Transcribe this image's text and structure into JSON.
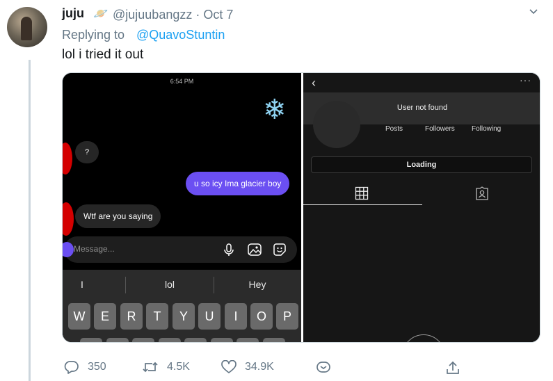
{
  "tweet": {
    "author_name": "juju",
    "author_emoji": "🪐",
    "handle": "@jujuubangzz",
    "separator": "·",
    "date": "Oct 7",
    "replying_prefix": "Replying to",
    "replying_to": "@QuavoStuntin",
    "text": "lol i tried it out"
  },
  "left_screenshot": {
    "status_time": "6:54 PM",
    "sticker": "❄",
    "messages": {
      "incoming_1": "?",
      "outgoing": "u so icy Ima glacier boy",
      "incoming_2": "Wtf are you saying"
    },
    "composer_placeholder": "Message...",
    "suggestions": [
      "I",
      "lol",
      "Hey"
    ],
    "keys_row": [
      "W",
      "E",
      "R",
      "T",
      "Y",
      "U",
      "I",
      "O",
      "P"
    ]
  },
  "right_screenshot": {
    "back_icon": "‹",
    "more_icon": "···",
    "status": "User not found",
    "stats": [
      "Posts",
      "Followers",
      "Following"
    ],
    "button": "Loading"
  },
  "actions": {
    "replies": "350",
    "retweets": "4.5K",
    "likes": "34.9K"
  },
  "colors": {
    "twitter_blue": "#1da1f2",
    "muted": "#657786",
    "sent_bubble": "#6b4ff2"
  }
}
